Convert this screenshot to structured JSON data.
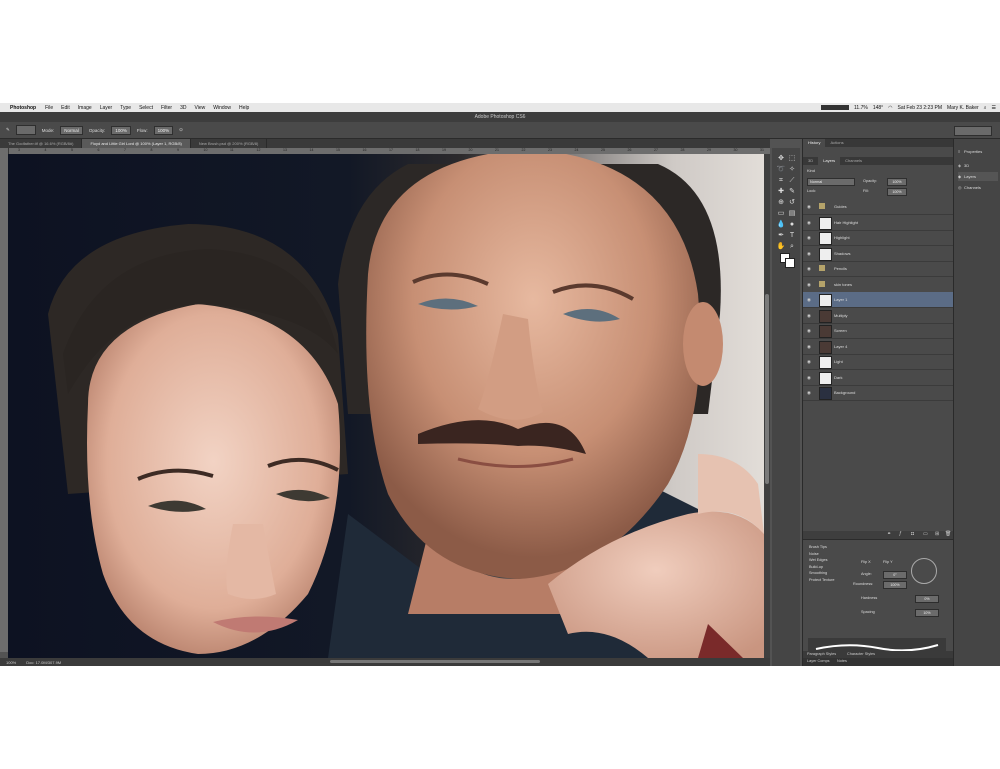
{
  "menubar": {
    "app_name": "Photoshop",
    "items": [
      "File",
      "Edit",
      "Image",
      "Layer",
      "Type",
      "Select",
      "Filter",
      "3D",
      "View",
      "Window",
      "Help"
    ],
    "clock": "Sat Feb 23  2:23 PM",
    "user": "Mary K. Baker",
    "battery": "148°",
    "status_small": "11.7%"
  },
  "window": {
    "title": "Adobe Photoshop CS6"
  },
  "options_bar": {
    "mode_label": "Mode:",
    "mode_value": "Normal",
    "opacity_label": "Opacity:",
    "opacity_value": "100%",
    "flow_label": "Flow:",
    "flow_value": "100%"
  },
  "doc_tabs": [
    {
      "label": "The Godfather.tif @ 16.6% (RGB/8#)",
      "active": false
    },
    {
      "label": "Floyd and Little Girl Lord @ 100% (Layer 1, RGB/8)",
      "active": true
    },
    {
      "label": "New Brush.psd @ 200% (RGB/8)",
      "active": false
    }
  ],
  "ruler_ticks": [
    "3",
    "4",
    "5",
    "6",
    "7",
    "8",
    "9",
    "10",
    "11",
    "12",
    "13",
    "14",
    "15",
    "16",
    "17",
    "18",
    "19",
    "20",
    "21",
    "22",
    "23",
    "24",
    "25",
    "26",
    "27",
    "28",
    "29",
    "30",
    "31"
  ],
  "status_bar": {
    "zoom": "100%",
    "doc_size": "Doc: 17.0M/307.9M"
  },
  "tools": [
    "move",
    "marquee",
    "lasso",
    "quick-select",
    "crop",
    "eyedropper",
    "healing",
    "brush",
    "clone",
    "history-brush",
    "eraser",
    "gradient",
    "blur",
    "dodge",
    "pen",
    "type",
    "path-select",
    "shape",
    "hand",
    "zoom"
  ],
  "panels": {
    "top_tabs": [
      "History",
      "Actions"
    ],
    "layer_tabs": [
      "3D",
      "Layers",
      "Channels"
    ],
    "kind_label": "Kind",
    "blend_mode": "Normal",
    "opacity_label": "Opacity:",
    "opacity_value": "100%",
    "lock_label": "Lock:",
    "fill_label": "Fill:",
    "fill_value": "100%",
    "layers": [
      {
        "name": "Guides",
        "type": "group",
        "selected": false
      },
      {
        "name": "Hair Highlight",
        "type": "layer",
        "selected": false
      },
      {
        "name": "Highlight",
        "type": "layer",
        "selected": false
      },
      {
        "name": "Shadows",
        "type": "layer",
        "selected": false
      },
      {
        "name": "Pencils",
        "type": "group",
        "selected": false
      },
      {
        "name": "skin tones",
        "type": "group",
        "selected": false
      },
      {
        "name": "Layer 1",
        "type": "layer",
        "selected": true
      },
      {
        "name": "Multiply",
        "type": "layer",
        "selected": false
      },
      {
        "name": "Screen",
        "type": "layer",
        "selected": false
      },
      {
        "name": "Layer 4",
        "type": "layer",
        "selected": false
      },
      {
        "name": "Light",
        "type": "layer",
        "selected": false
      },
      {
        "name": "Dark",
        "type": "layer",
        "selected": false
      },
      {
        "name": "Background",
        "type": "layer",
        "selected": false
      }
    ]
  },
  "brush_panel": {
    "options": [
      "Brush Tips",
      "Noise",
      "Wet Edges",
      "Build-up",
      "Smoothing",
      "Protect Texture"
    ],
    "flip_x": "Flip X",
    "flip_y": "Flip Y",
    "angle_label": "Angle:",
    "angle_value": "0°",
    "roundness_label": "Roundness:",
    "roundness_value": "100%",
    "hardness_label": "Hardness",
    "hardness_value": "0%",
    "spacing_label": "Spacing",
    "spacing_value": "10%"
  },
  "bottom_tabs": [
    "Paragraph Styles",
    "Character Styles"
  ],
  "bottom_row": [
    "Layer Comps",
    "Notes"
  ],
  "far_right": [
    "Properties",
    "3D",
    "Layers",
    "Channels"
  ]
}
